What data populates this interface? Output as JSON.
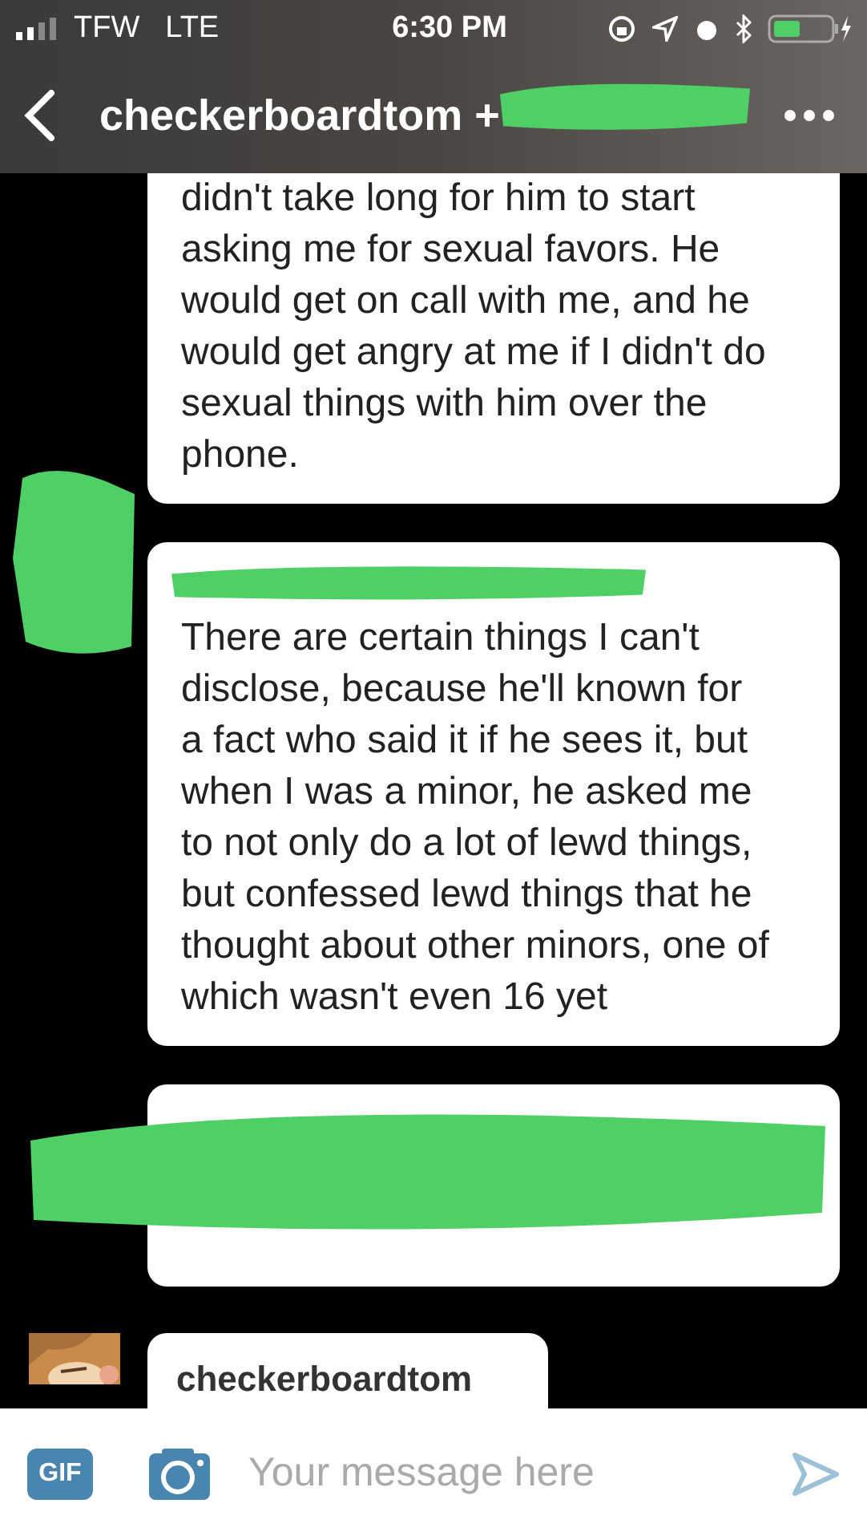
{
  "status_bar": {
    "carrier": "TFW",
    "network": "LTE",
    "time": "6:30 PM"
  },
  "header": {
    "title": "checkerboardtom +",
    "title_redacted": true
  },
  "messages": [
    {
      "kind": "text",
      "text": "didn't take long for him to start asking me for sexual favors. He would get on call with me, and he would get angry at me if I didn't do sexual things with him over the phone."
    },
    {
      "kind": "text",
      "avatar_redacted": true,
      "sender_redacted": true,
      "text": "There are certain things I can't disclose, because he'll known for a fact who said it if he sees it, but when I was a minor, he asked me to not only do a lot of lewd things, but confessed lewd things that he thought about other minors, one of which wasn't even 16 yet"
    },
    {
      "kind": "redacted"
    },
    {
      "kind": "sender",
      "sender": "checkerboardtom"
    }
  ],
  "composer": {
    "gif": "GIF",
    "placeholder": "Your message here"
  }
}
